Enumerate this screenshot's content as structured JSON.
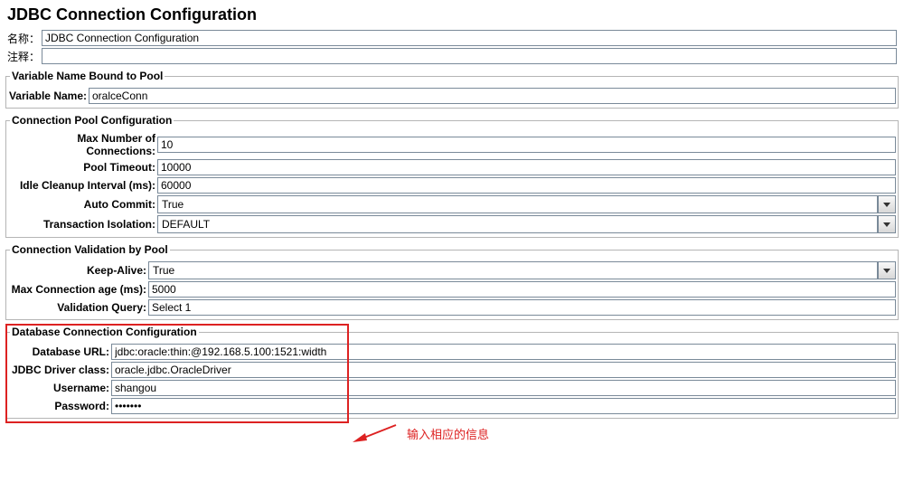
{
  "title": "JDBC Connection Configuration",
  "nameLabel": "名称：",
  "nameValue": "JDBC Connection Configuration",
  "commentLabel": "注释：",
  "commentValue": "",
  "variableSection": {
    "legend": "Variable Name Bound to Pool",
    "label": "Variable Name:",
    "value": "oralceConn"
  },
  "poolSection": {
    "legend": "Connection Pool Configuration",
    "maxConnLabel": "Max Number of Connections:",
    "maxConnValue": "10",
    "poolTimeoutLabel": "Pool Timeout:",
    "poolTimeoutValue": "10000",
    "idleLabel": "Idle Cleanup Interval (ms):",
    "idleValue": "60000",
    "autoCommitLabel": "Auto Commit:",
    "autoCommitValue": "True",
    "txIsoLabel": "Transaction Isolation:",
    "txIsoValue": "DEFAULT"
  },
  "validationSection": {
    "legend": "Connection Validation by Pool",
    "keepAliveLabel": "Keep-Alive:",
    "keepAliveValue": "True",
    "maxAgeLabel": "Max Connection age (ms):",
    "maxAgeValue": "5000",
    "valQueryLabel": "Validation Query:",
    "valQueryValue": "Select 1"
  },
  "dbSection": {
    "legend": "Database Connection Configuration",
    "urlLabel": "Database URL:",
    "urlValue": "jdbc:oracle:thin:@192.168.5.100:1521:width",
    "driverLabel": "JDBC Driver class:",
    "driverValue": "oracle.jdbc.OracleDriver",
    "userLabel": "Username:",
    "userValue": "shangou",
    "passLabel": "Password:",
    "passValue": "•••••••"
  },
  "annotation": "输入相应的信息"
}
